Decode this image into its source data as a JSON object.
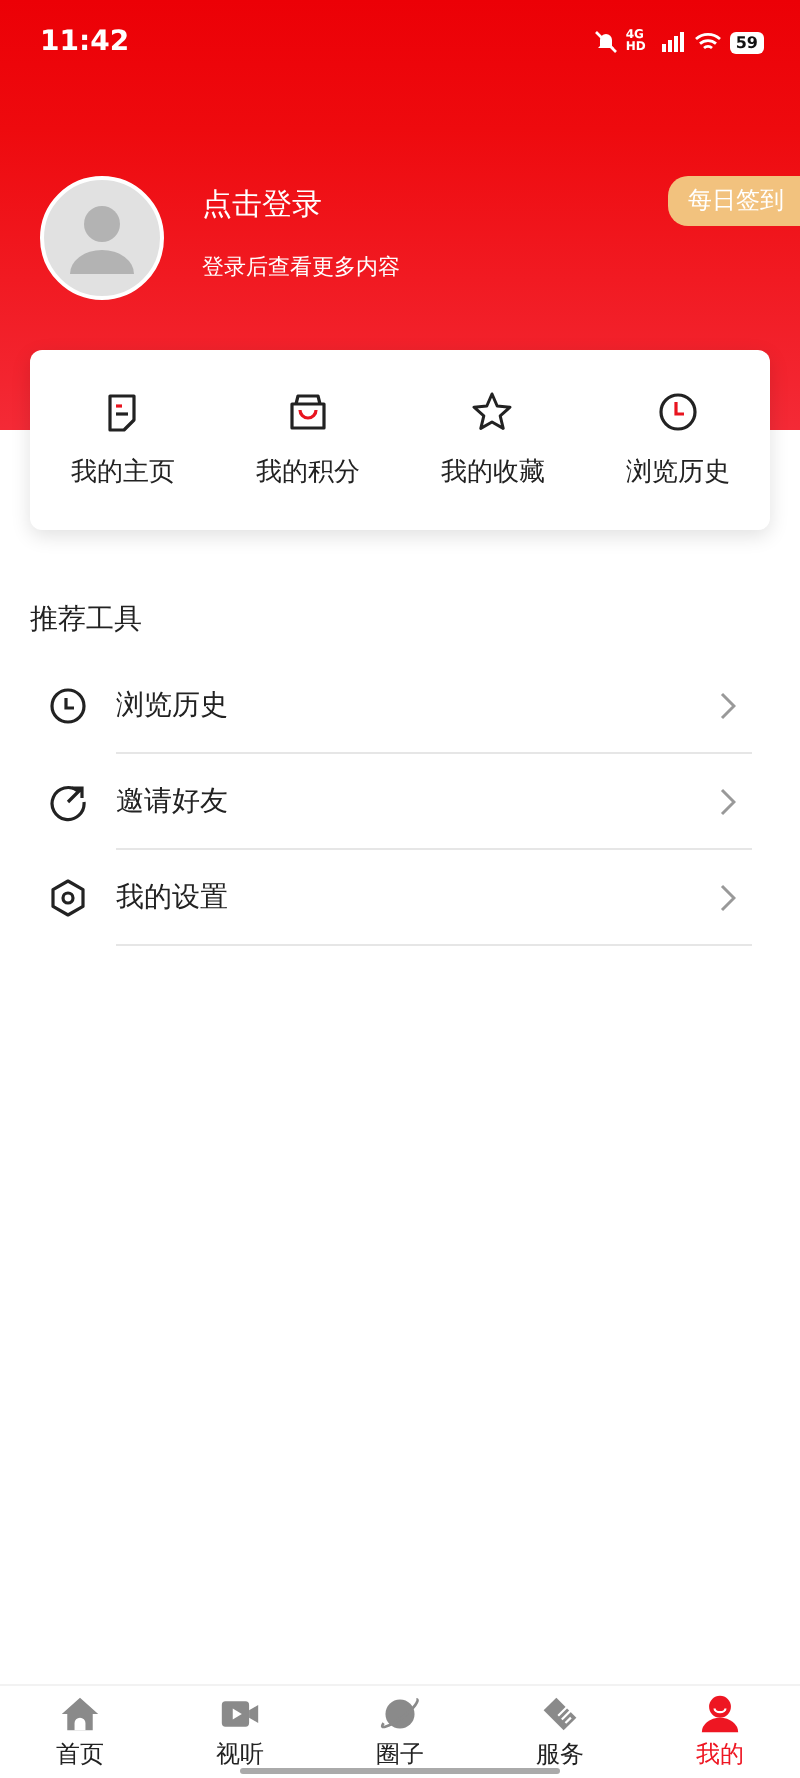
{
  "status_bar": {
    "time": "11:42",
    "network": "4G HD",
    "battery": "59"
  },
  "profile": {
    "title": "点击登录",
    "subtitle": "登录后查看更多内容",
    "checkin": "每日签到"
  },
  "quick_links": [
    {
      "label": "我的主页"
    },
    {
      "label": "我的积分"
    },
    {
      "label": "我的收藏"
    },
    {
      "label": "浏览历史"
    }
  ],
  "tools": {
    "title": "推荐工具",
    "items": [
      {
        "label": "浏览历史"
      },
      {
        "label": "邀请好友"
      },
      {
        "label": "我的设置"
      }
    ]
  },
  "tab_bar": [
    {
      "label": "首页",
      "selected": false
    },
    {
      "label": "视听",
      "selected": false
    },
    {
      "label": "圈子",
      "selected": false
    },
    {
      "label": "服务",
      "selected": false
    },
    {
      "label": "我的",
      "selected": true
    }
  ]
}
